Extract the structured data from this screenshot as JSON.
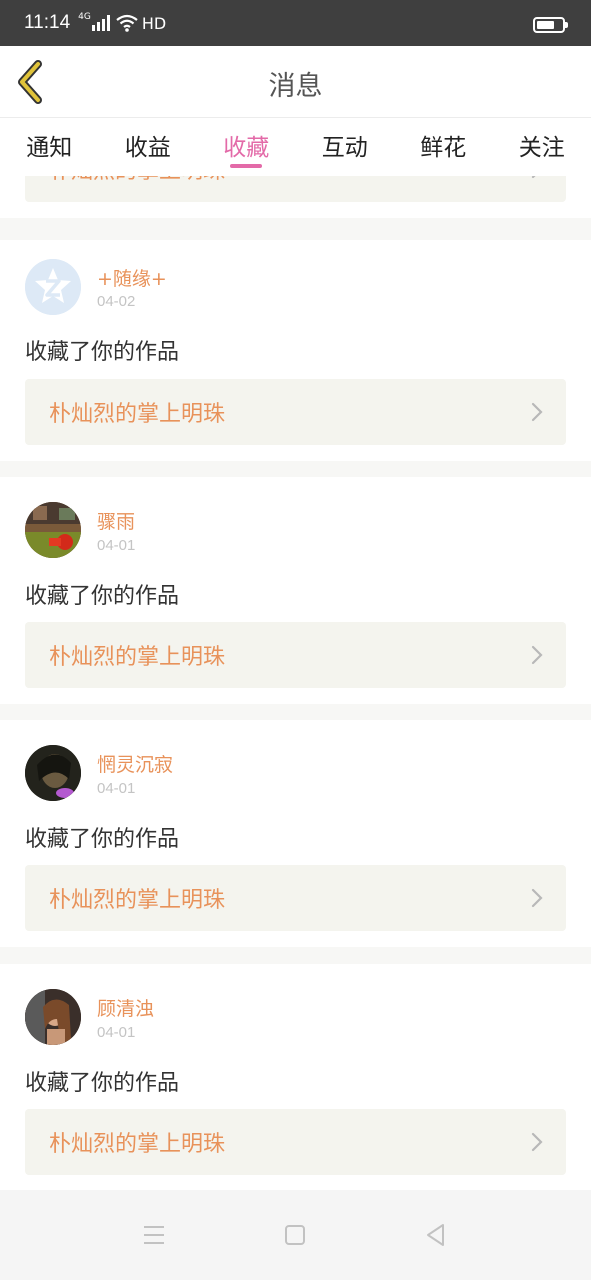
{
  "status_bar": {
    "time": "11:14",
    "network": "4G",
    "hd": "HD"
  },
  "header": {
    "title": "消息"
  },
  "tabs": [
    {
      "label": "通知",
      "active": false
    },
    {
      "label": "收益",
      "active": false
    },
    {
      "label": "收藏",
      "active": true
    },
    {
      "label": "互动",
      "active": false
    },
    {
      "label": "鲜花",
      "active": false
    },
    {
      "label": "关注",
      "active": false
    }
  ],
  "partial_item": {
    "work_title": "朴灿烈的掌上明珠"
  },
  "notifications": [
    {
      "user": "+随缘+",
      "date": "04-02",
      "action": "收藏了你的作品",
      "work_title": "朴灿烈的掌上明珠",
      "avatar": "qq-default-avatar"
    },
    {
      "user": "骤雨",
      "date": "04-01",
      "action": "收藏了你的作品",
      "work_title": "朴灿烈的掌上明珠",
      "avatar": "photo-avatar"
    },
    {
      "user": "惘灵沉寂",
      "date": "04-01",
      "action": "收藏了你的作品",
      "work_title": "朴灿烈的掌上明珠",
      "avatar": "photo-avatar"
    },
    {
      "user": "顾清浊",
      "date": "04-01",
      "action": "收藏了你的作品",
      "work_title": "朴灿烈的掌上明珠",
      "avatar": "photo-avatar"
    }
  ],
  "colors": {
    "accent_pink": "#e36aa8",
    "user_orange": "#e8925a",
    "back_yellow": "#e0c33a",
    "link_bg": "#f4f4ee"
  }
}
